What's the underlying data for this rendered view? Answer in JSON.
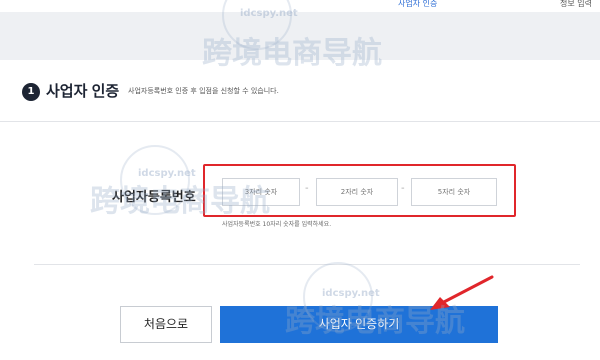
{
  "nav": {
    "active_tab": "사업자 인증",
    "right_link": "정보 입력"
  },
  "step": {
    "number": "1",
    "title": "사업자 인증",
    "description": "사업자등록번호 인증 후 입점을 신청할 수 있습니다."
  },
  "form": {
    "label": "사업자등록번호",
    "inputs": [
      {
        "placeholder": "3자리 숫자",
        "value": ""
      },
      {
        "placeholder": "2자리 숫자",
        "value": ""
      },
      {
        "placeholder": "5자리 숫자",
        "value": ""
      }
    ],
    "separator": "-",
    "hint": "사업자등록번호 10자리 숫자를 입력하세요."
  },
  "buttons": {
    "first": "처음으로",
    "verify": "사업자 인증하기"
  },
  "watermark": {
    "text": "跨境电商导航",
    "site": "idcspy.net"
  },
  "colors": {
    "primary": "#1f72d8",
    "highlight": "#e0262b",
    "dark": "#1d2433"
  }
}
